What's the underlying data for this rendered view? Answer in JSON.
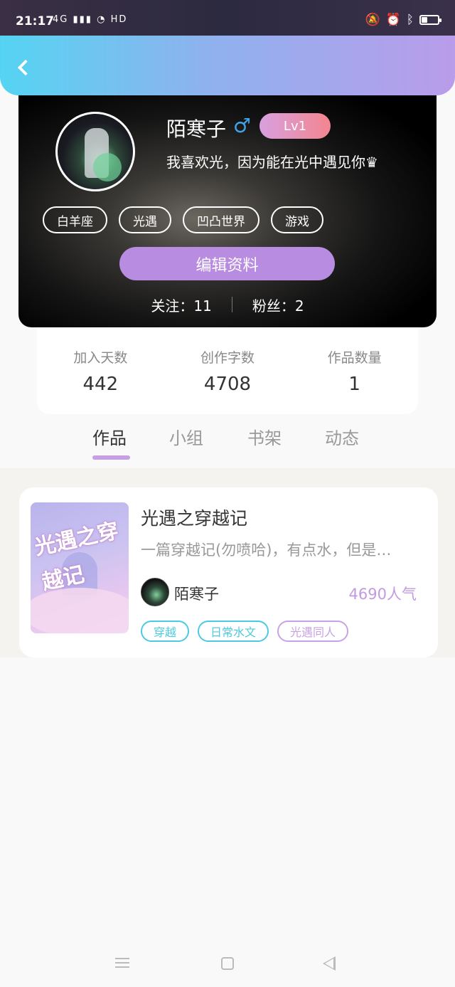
{
  "status_bar": {
    "time": "21:17",
    "network": "4G",
    "hd": "HD",
    "icons": [
      "signal-icon",
      "wifi-icon",
      "mute-icon",
      "alarm-icon",
      "bluetooth-icon",
      "battery-icon"
    ],
    "battery_level": 0.35
  },
  "header": {
    "back_icon": "chevron-left-icon",
    "gradient": [
      "#55d4f2",
      "#b99cea"
    ]
  },
  "profile": {
    "name": "陌寒子",
    "gender_symbol": "♂",
    "level": "Lv1",
    "bio": "我喜欢光，因为能在光中遇见你♛",
    "tags": [
      "白羊座",
      "光遇",
      "凹凸世界",
      "游戏"
    ],
    "edit_label": "编辑资料",
    "following": "关注：11",
    "followers": "粉丝：2"
  },
  "stats": [
    {
      "label": "加入天数",
      "value": "442"
    },
    {
      "label": "创作字数",
      "value": "4708"
    },
    {
      "label": "作品数量",
      "value": "1"
    }
  ],
  "tabs": [
    {
      "label": "作品",
      "active": true
    },
    {
      "label": "小组",
      "active": false
    },
    {
      "label": "书架",
      "active": false
    },
    {
      "label": "动态",
      "active": false
    }
  ],
  "works": [
    {
      "cover_text": "光遇之穿越记",
      "title": "光遇之穿越记",
      "description": "一篇穿越记(勿喷哈)，有点水，但是…",
      "author": "陌寒子",
      "popularity": "4690人气",
      "tags": [
        {
          "label": "穿越",
          "color": "#4ccbe0"
        },
        {
          "label": "日常水文",
          "color": "#4ccbe0"
        },
        {
          "label": "光遇同人",
          "color": "#c9a2e3"
        }
      ]
    }
  ],
  "colors": {
    "accent": "#b88ce0",
    "popularity": "#c39ae0",
    "gender": "#3fa3e8"
  }
}
